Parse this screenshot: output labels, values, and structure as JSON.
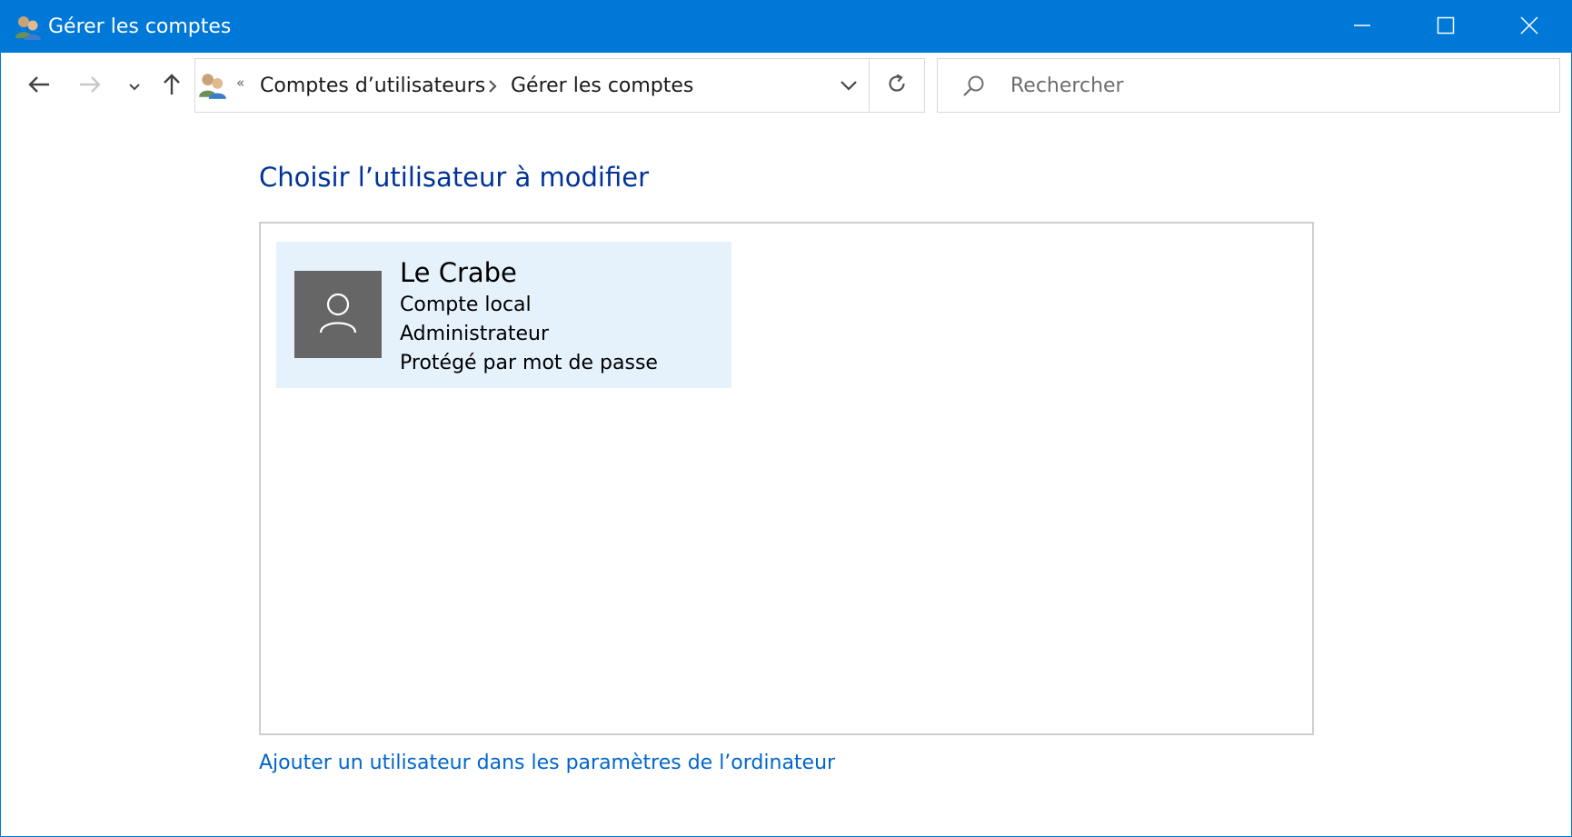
{
  "window": {
    "title": "Gérer les comptes",
    "accent_color": "#0078d7",
    "controls": {
      "minimize_icon": "minimize-icon",
      "maximize_icon": "maximize-icon",
      "close_icon": "close-icon"
    }
  },
  "navigation": {
    "back_icon": "arrow-left-icon",
    "forward_icon": "arrow-right-icon",
    "recent_icon": "chevron-down-icon",
    "up_icon": "arrow-up-icon",
    "address": {
      "overflow_chevrons": "«",
      "breadcrumbs": [
        "Comptes d’utilisateurs",
        "Gérer les comptes"
      ],
      "dropdown_icon": "chevron-down-icon",
      "refresh_icon": "refresh-icon"
    },
    "search": {
      "placeholder": "Rechercher",
      "value": ""
    }
  },
  "main": {
    "heading": "Choisir l’utilisateur à modifier",
    "heading_color": "#003399",
    "accounts": [
      {
        "name": "Le Crabe",
        "details": [
          "Compte local",
          "Administrateur",
          "Protégé par mot de passe"
        ],
        "avatar_icon": "user-icon",
        "selected": true,
        "highlight_color": "#e5f1fb"
      }
    ],
    "add_user_link": "Ajouter un utilisateur dans les paramètres de l’ordinateur",
    "link_color": "#0066cc"
  }
}
